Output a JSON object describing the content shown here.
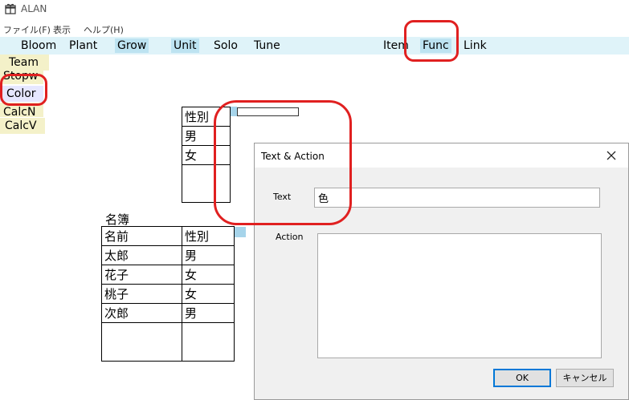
{
  "window": {
    "title": "ALAN",
    "icon": "gift-icon"
  },
  "menubar": [
    "ファイル(F)",
    "表示",
    "ヘルプ(H)"
  ],
  "toolbar": [
    "Bloom",
    "Plant",
    "Grow",
    "Unit",
    "Solo",
    "Tune",
    "Item",
    "Func",
    "Link"
  ],
  "left_menu": [
    "Team",
    "Stopw",
    "Color",
    "CalcN",
    "CalcV"
  ],
  "gender_table": {
    "header": "性別",
    "rows": [
      "男",
      "女"
    ]
  },
  "roster": {
    "caption": "名簿",
    "columns": [
      "名前",
      "性別"
    ],
    "rows": [
      [
        "太郎",
        "男"
      ],
      [
        "花子",
        "女"
      ],
      [
        "桃子",
        "女"
      ],
      [
        "次郎",
        "男"
      ]
    ]
  },
  "dialog": {
    "title": "Text & Action",
    "text_label": "Text",
    "text_value": "色",
    "action_label": "Action",
    "action_value": "",
    "ok_label": "OK",
    "cancel_label": "キャンセル",
    "close_icon": "close-icon"
  },
  "colors": {
    "toolbar_bg": "#dff3f9",
    "toolbar_selected": "#bde3f1",
    "left_menu_bg": "#f4f1c9",
    "left_menu_selected": "#e6e7ff",
    "highlight": "#e02020",
    "dialog_bg": "#f0f0f0",
    "ok_border": "#0078d7"
  }
}
